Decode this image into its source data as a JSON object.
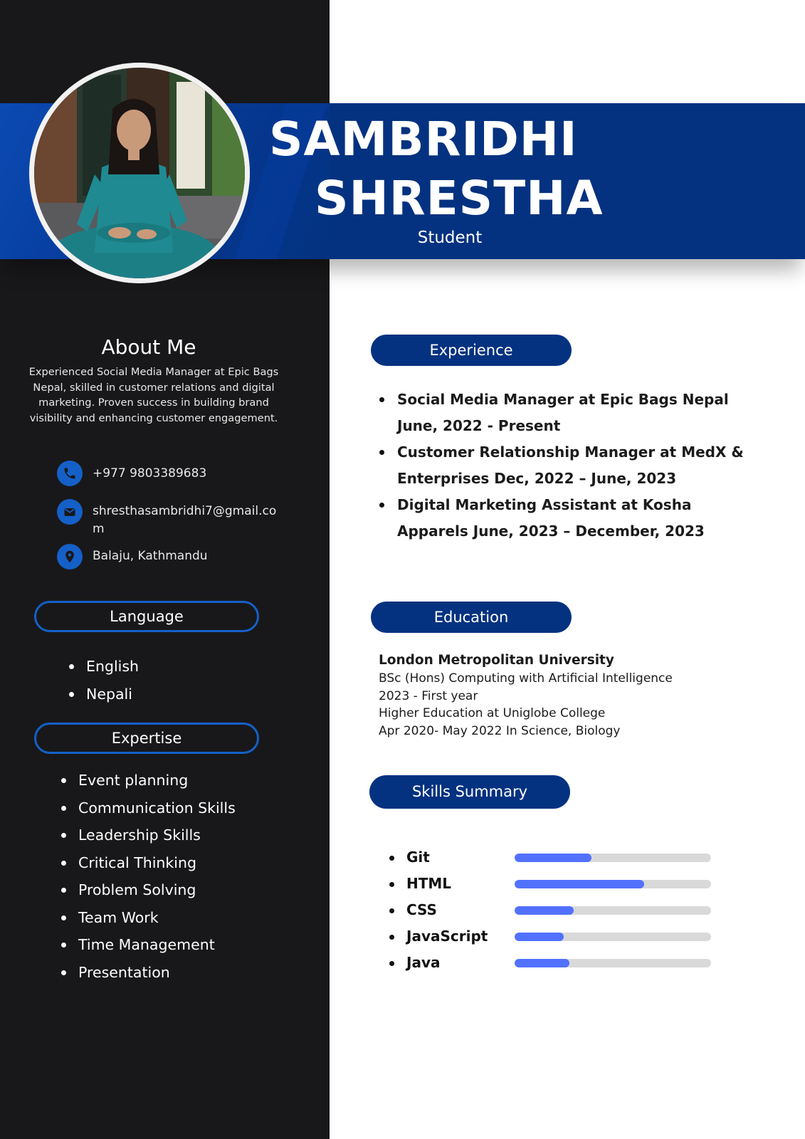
{
  "header": {
    "first_name": "SAMBRIDHI",
    "last_name": "SHRESTHA",
    "role": "Student"
  },
  "about": {
    "title": "About Me",
    "text": "Experienced Social Media Manager at Epic Bags Nepal, skilled in customer relations and digital marketing. Proven success in building brand visibility and enhancing customer engagement."
  },
  "contact": {
    "phone": "+977 9803389683",
    "email": "shresthasambridhi7@gmail.com",
    "location": "Balaju, Kathmandu",
    "icons": [
      "phone-icon",
      "mail-icon",
      "location-pin-icon"
    ]
  },
  "language": {
    "title": "Language",
    "items": [
      "English",
      "Nepali"
    ]
  },
  "expertise": {
    "title": "Expertise",
    "items": [
      "Event planning",
      "Communication Skills",
      "Leadership Skills",
      "Critical Thinking",
      "Problem Solving",
      "Team Work",
      "Time Management",
      "Presentation"
    ]
  },
  "experience": {
    "title": "Experience",
    "items": [
      "Social Media Manager at Epic Bags Nepal June, 2022 - Present",
      "Customer Relationship Manager at MedX & Enterprises Dec, 2022 – June, 2023",
      "Digital Marketing Assistant at Kosha Apparels June, 2023 – December, 2023"
    ]
  },
  "education": {
    "title": "Education",
    "university": "London Metropolitan University",
    "lines": [
      "BSc (Hons) Computing with Artificial Intelligence",
      "2023 - First year",
      "Higher Education at Uniglobe College",
      "Apr 2020- May 2022 In Science, Biology"
    ]
  },
  "skills": {
    "title": "Skills Summary",
    "items": [
      {
        "name": "Git",
        "level": 0.39
      },
      {
        "name": "HTML",
        "level": 0.66
      },
      {
        "name": "CSS",
        "level": 0.3
      },
      {
        "name": "JavaScript",
        "level": 0.25
      },
      {
        "name": "Java",
        "level": 0.28
      }
    ]
  },
  "colors": {
    "navy": "#043280",
    "sidebar": "#18181a",
    "accent_blue": "#1560c8",
    "bar_fill": "#5271ff",
    "bar_track": "#d9d9d9"
  }
}
